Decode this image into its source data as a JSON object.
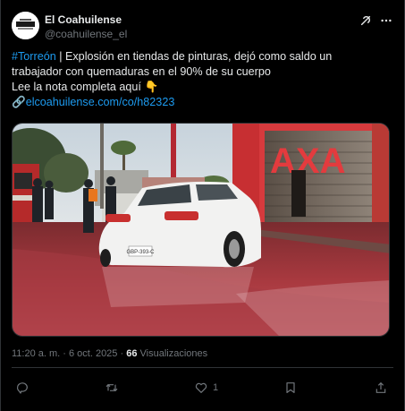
{
  "post": {
    "author_name": "El Coahuilense",
    "author_handle": "@coahuilense_el",
    "avatar_text": "EL COAHUILENSE",
    "text": {
      "hashtag": "#Torreón",
      "line1_rest": " | Explosión en tiendas de pinturas, dejó como saldo un",
      "line2": "trabajador con quemaduras en el 90% de su cuerpo",
      "line3": "Lee la nota completa aquí ",
      "line3_emoji": "👇",
      "link_emoji": "🔗",
      "link": "elcoahuilense.com/co/h82323"
    },
    "media": {
      "store_sign": "AXA",
      "plate": "GBP-393-C"
    },
    "meta": {
      "time": "11:20 a. m. · 6 oct. 2025 · ",
      "views_count": "66",
      "views_label": " Visualizaciones"
    },
    "actions": {
      "reply_count": "",
      "retweet_count": "",
      "like_count": "1",
      "bookmark_count": ""
    }
  },
  "icons": {
    "grok": "grok-icon",
    "more": "more-icon",
    "reply": "reply-icon",
    "retweet": "retweet-icon",
    "like": "like-icon",
    "bookmark": "bookmark-icon",
    "share": "share-icon"
  },
  "colors": {
    "background": "#000000",
    "text": "#e7e9ea",
    "secondary": "#71767b",
    "link": "#1d9bf0",
    "border": "#2f3336"
  }
}
